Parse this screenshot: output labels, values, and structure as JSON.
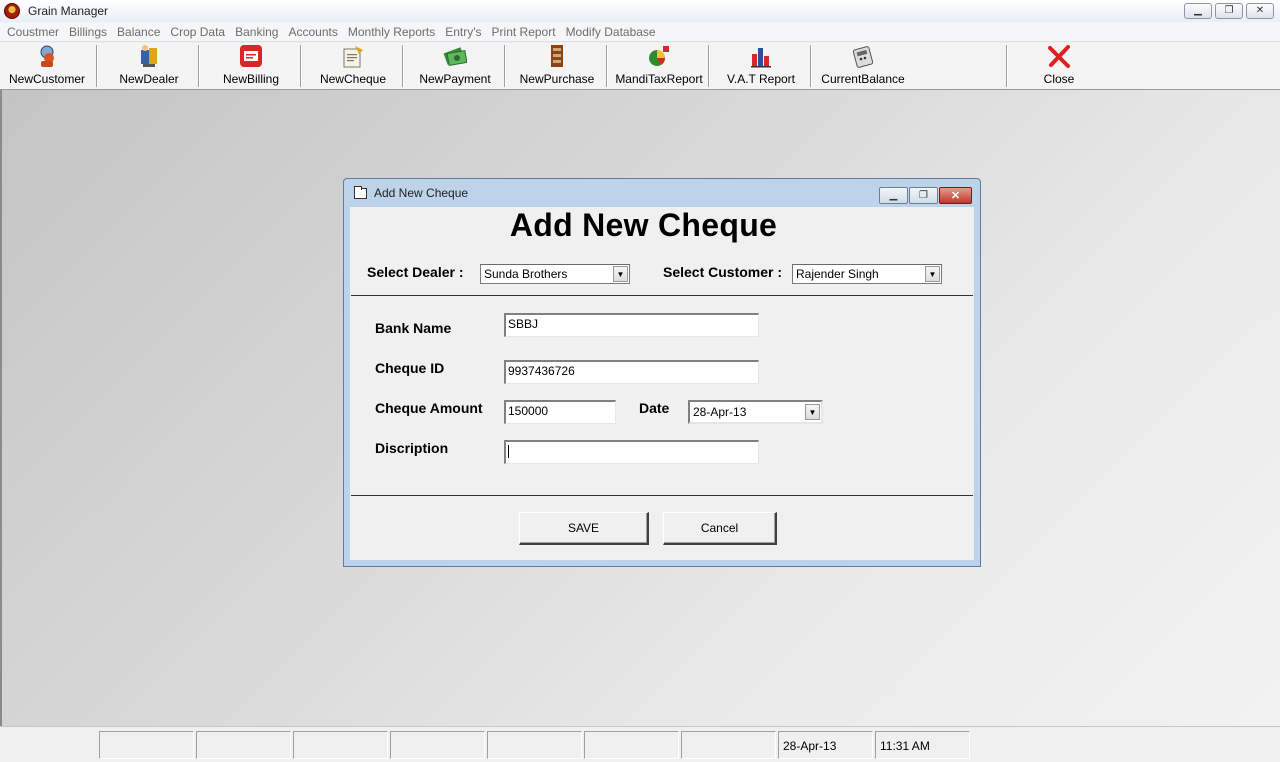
{
  "window": {
    "title": "Grain Manager",
    "min": "▁",
    "restore": "❐",
    "close": "✕"
  },
  "menu": [
    "Coustmer",
    "Billings",
    "Balance",
    "Crop Data",
    "Banking",
    "Accounts",
    "Monthly Reports",
    "Entry's",
    "Print Report",
    "Modify Database"
  ],
  "toolbar": {
    "new_customer": "NewCustomer",
    "new_dealer": "NewDealer",
    "new_billing": "NewBilling",
    "new_cheque": "NewCheque",
    "new_payment": "NewPayment",
    "new_purchase": "NewPurchase",
    "mandi_tax_report": "MandiTaxReport",
    "vat_report": "V.A.T Report",
    "current_balance": "CurrentBalance",
    "close": "Close"
  },
  "dialog": {
    "title": "Add New Cheque",
    "heading": "Add New Cheque",
    "select_dealer_label": "Select Dealer :",
    "select_dealer_value": "Sunda Brothers",
    "select_customer_label": "Select Customer :",
    "select_customer_value": "Rajender Singh",
    "bank_name_label": "Bank Name",
    "bank_name_value": "SBBJ",
    "cheque_id_label": "Cheque ID",
    "cheque_id_value": "9937436726",
    "cheque_amount_label": "Cheque Amount",
    "cheque_amount_value": "150000",
    "date_label": "Date",
    "date_value": "28-Apr-13",
    "description_label": "Discription",
    "description_value": "",
    "save_label": "SAVE",
    "cancel_label": "Cancel",
    "arrow": "▼"
  },
  "status": {
    "date": "28-Apr-13",
    "time": "11:31 AM"
  }
}
